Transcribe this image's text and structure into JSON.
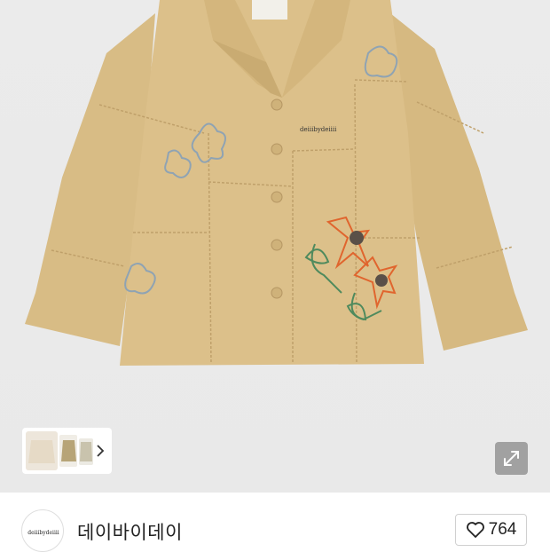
{
  "product": {
    "image_alt": "embroidered beige jacket",
    "jacket_color": "#dcc08a",
    "gallery": {
      "thumbnail_count": 3,
      "next_icon": "chevron-right-icon",
      "expand_icon": "expand-arrows-icon"
    },
    "label_text": "deiiibydeiiii"
  },
  "store": {
    "name": "데이바이데이",
    "logo_text": "deiiibydeiiii"
  },
  "likes": {
    "icon": "heart-outline-icon",
    "count": "764"
  }
}
